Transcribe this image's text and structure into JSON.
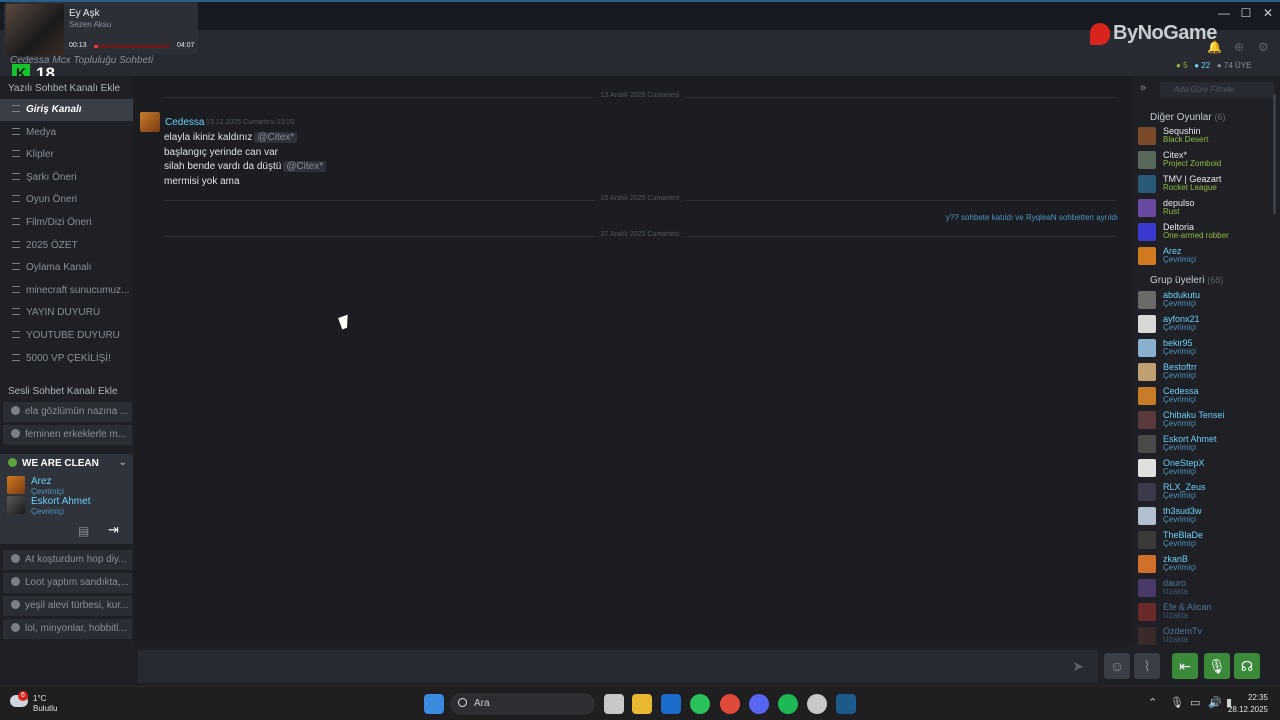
{
  "media": {
    "title": "Ey Aşk",
    "artist": "Sezen Aksu",
    "elapsed": "00:13",
    "duration": "04:07",
    "progress": 0.05
  },
  "rating": {
    "letter": "K",
    "age": "18"
  },
  "brand": {
    "name": "ByNoGame"
  },
  "header": {
    "group_name": "Cedessa Mcx Topluluğu Sohbeti",
    "counts": {
      "in_game": "5",
      "online": "22",
      "members": "74 ÜYE"
    }
  },
  "sidebar": {
    "text_section": "Yazılı Sohbet Kanalı Ekle",
    "text_channels": [
      "Giriş Kanalı",
      "Medya",
      "Klipler",
      "Şarkı Öneri",
      "Oyun Öneri",
      "Film/Dizi Öneri",
      "2025 ÖZET",
      "Oylama Kanalı",
      "minecraft sunucumuz...",
      "YAYIN DUYURU",
      "YOUTUBE DUYURU",
      "5000 VP ÇEKİLİŞİ!"
    ],
    "voice_section": "Sesli Sohbet Kanalı Ekle",
    "voice_channels_top": [
      "ela gözlümün nazına ...",
      "feminen erkeklerle m..."
    ],
    "active_voice": {
      "name": "WE ARE CLEAN",
      "users": [
        {
          "name": "Arez",
          "status": "Çevrimiçi"
        },
        {
          "name": "Eskort Ahmet",
          "status": "Çevrimiçi"
        }
      ]
    },
    "voice_channels_bottom": [
      "At koşturdum hop diy...",
      "Loot yaptım sandıkta,...",
      "yeşil alevi türbesi, kur...",
      "lol, minyonlar, hobbitl..."
    ]
  },
  "chat": {
    "date1": "13 Aralık 2025 Cumartesi",
    "message": {
      "author": "Cedessa",
      "timestamp": "13.12.2025 Cumartesi 23:00",
      "lines": [
        {
          "text": "elayla ikiniz kaldınız",
          "mention": "@Citex*"
        },
        {
          "text": "başlangıç yerinde can var",
          "mention": ""
        },
        {
          "text": "silah bende vardı da düştü",
          "mention": "@Citex*"
        },
        {
          "text": "mermisi yok ama",
          "mention": ""
        }
      ]
    },
    "date2": "15 Aralık 2025 Cumartesi",
    "system_message": "y?? sohbete katıldı ve RyqleaN sohbetten ayrıldı",
    "date3": "27 Aralık 2025 Cumartesi",
    "input_placeholder": ""
  },
  "members_panel": {
    "filter_placeholder": "Ada Göre Filtrele",
    "other_games_label": "Diğer Oyunlar",
    "other_games_count": "(6)",
    "in_game": [
      {
        "name": "Sequshin",
        "status": "Black Desert",
        "color": "#7a4a2a"
      },
      {
        "name": "Citex*",
        "status": "Project Zomboid",
        "color": "#5a6a5a"
      },
      {
        "name": "TMV | Geazart",
        "status": "Rocket League",
        "color": "#2a5a7a"
      },
      {
        "name": "depulso",
        "status": "Rust",
        "color": "#6a4aa0"
      },
      {
        "name": "Deltoria",
        "status": "One-armed robber",
        "color": "#3a3ad0"
      },
      {
        "name": "Arez",
        "status": "Çevrimiçi",
        "color": "#d07a20"
      }
    ],
    "group_label": "Grup üyeleri",
    "group_count": "(68)",
    "members": [
      {
        "name": "abdukutu",
        "status": "Çevrimiçi",
        "state": "online",
        "color": "#6a6a6a"
      },
      {
        "name": "ayfonx21",
        "status": "Çevrimiçi",
        "state": "online",
        "color": "#d8d8d8"
      },
      {
        "name": "bekir95",
        "status": "Çevrimiçi",
        "state": "online",
        "color": "#8ab0d0"
      },
      {
        "name": "Bestoftrr",
        "status": "Çevrimiçi",
        "state": "online",
        "color": "#c0a070"
      },
      {
        "name": "Cedessa",
        "status": "Çevrimiçi",
        "state": "online",
        "color": "#c87c2a"
      },
      {
        "name": "Chibaku Tensei",
        "status": "Çevrimiçi",
        "state": "online",
        "color": "#5a3a3a"
      },
      {
        "name": "Eskort Ahmet",
        "status": "Çevrimiçi",
        "state": "online",
        "color": "#4a4a4a"
      },
      {
        "name": "OneStepX",
        "status": "Çevrimiçi",
        "state": "online",
        "color": "#e0e0e0"
      },
      {
        "name": "RLX_Zeus",
        "status": "Çevrimiçi",
        "state": "online",
        "color": "#3a3a4a"
      },
      {
        "name": "th3sud3w",
        "status": "Çevrimiçi",
        "state": "online",
        "color": "#b0c0d0"
      },
      {
        "name": "TheBlaDe",
        "status": "Çevrimiçi",
        "state": "online",
        "color": "#3a3a3a"
      },
      {
        "name": "zkanB",
        "status": "Çevrimiçi",
        "state": "online",
        "color": "#d0702a"
      },
      {
        "name": "dauro",
        "status": "Uzakta",
        "state": "away",
        "color": "#4a3a6a"
      },
      {
        "name": "Efe & Alican",
        "status": "Uzakta",
        "state": "away",
        "color": "#6a2a2a"
      },
      {
        "name": "OzdemTv",
        "status": "Uzakta",
        "state": "away",
        "color": "#3a2a2a"
      }
    ]
  },
  "taskbar": {
    "weather_temp": "1°C",
    "weather_cond": "Bulutlu",
    "weather_badge": "6",
    "search_label": "Ara",
    "time": "22:35",
    "date": "28.12.2025"
  }
}
